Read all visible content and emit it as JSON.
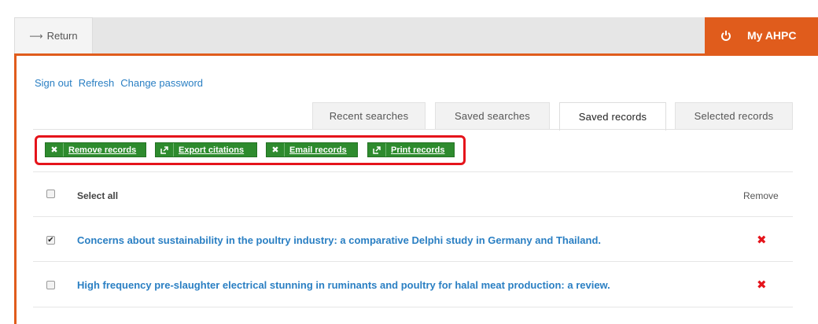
{
  "header": {
    "return_label": "Return",
    "return_icon": "arrow-left-icon",
    "my_ahpc_label": "My AHPC",
    "my_ahpc_icon": "logout-icon",
    "accent": "#e05c1c"
  },
  "auth_links": [
    "Sign out",
    "Refresh",
    "Change password"
  ],
  "tabs": [
    {
      "label": "Recent searches",
      "active": false
    },
    {
      "label": "Saved searches",
      "active": false
    },
    {
      "label": "Saved records",
      "active": true
    },
    {
      "label": "Selected records",
      "active": false
    }
  ],
  "actions": [
    {
      "label": "Remove records",
      "icon": "close-icon"
    },
    {
      "label": "Export citations",
      "icon": "external-link-icon"
    },
    {
      "label": "Email records",
      "icon": "close-icon"
    },
    {
      "label": "Print records",
      "icon": "external-link-icon"
    }
  ],
  "action_color": "#2e8b2e",
  "highlight_color": "#e5141b",
  "list": {
    "select_all_label": "Select all",
    "remove_header": "Remove",
    "records": [
      {
        "title": "Concerns about sustainability in the poultry industry: a comparative Delphi study in Germany and Thailand.",
        "checked": true
      },
      {
        "title": "High frequency pre-slaughter electrical stunning in ruminants and poultry for halal meat production: a review.",
        "checked": false
      }
    ]
  }
}
